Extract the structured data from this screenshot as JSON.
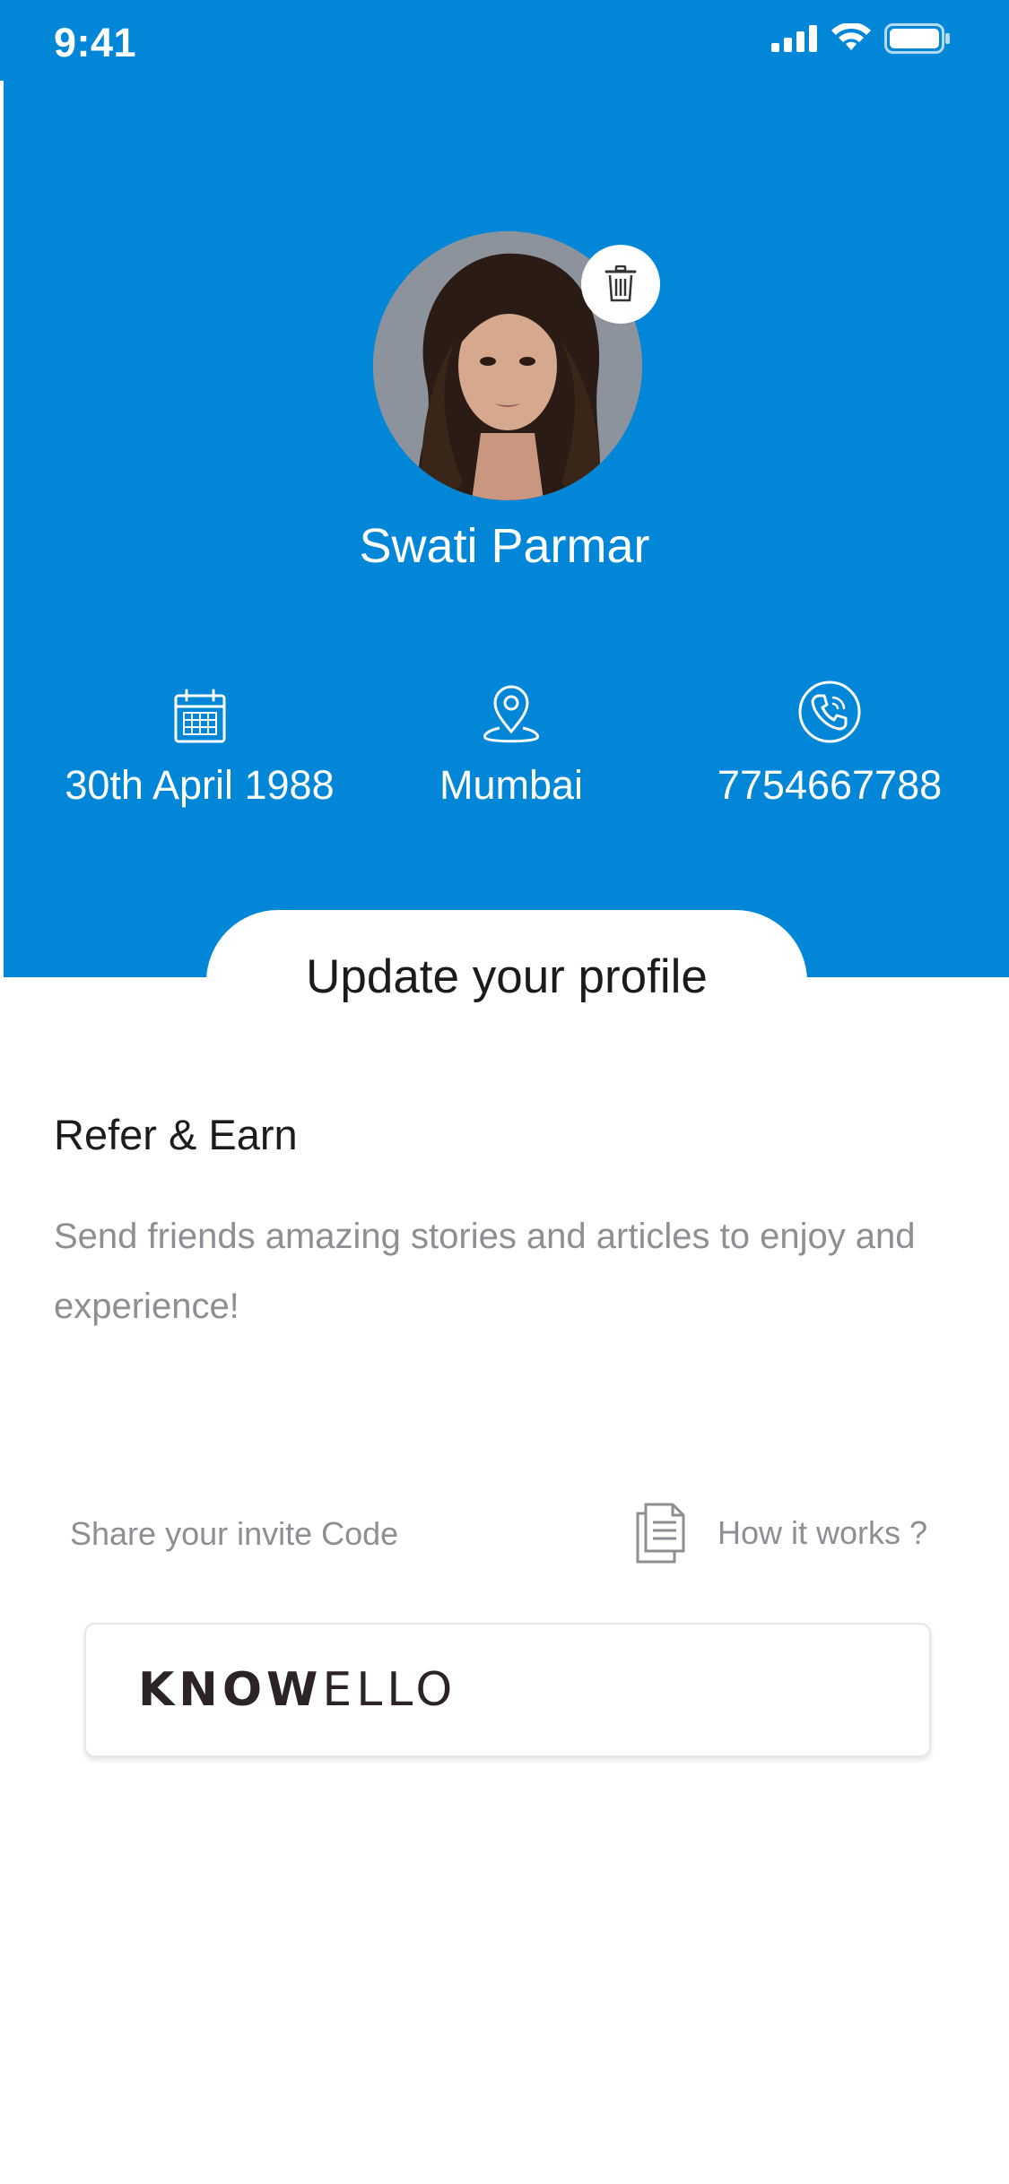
{
  "status_bar": {
    "time": "9:41"
  },
  "profile": {
    "name": "Swati Parmar"
  },
  "info": {
    "dob": "30th April 1988",
    "city": "Mumbai",
    "phone": "7754667788"
  },
  "update_profile": {
    "label": "Update your profile"
  },
  "refer": {
    "title": "Refer & Earn",
    "description": "Send friends amazing stories and articles to enjoy and experience!"
  },
  "invite": {
    "label": "Share your invite Code",
    "how_it_works": "How it works ?",
    "code_bold": "KNOW",
    "code_light": "ELLO"
  },
  "colors": {
    "header_blue": "#0287d8",
    "text_gray": "#8c8f93"
  },
  "icons": {
    "signal": "signal-icon",
    "wifi": "wifi-icon",
    "battery": "battery-icon",
    "delete": "trash-icon",
    "calendar": "calendar-icon",
    "location": "location-pin-icon",
    "phone": "phone-icon",
    "document": "document-icon"
  }
}
